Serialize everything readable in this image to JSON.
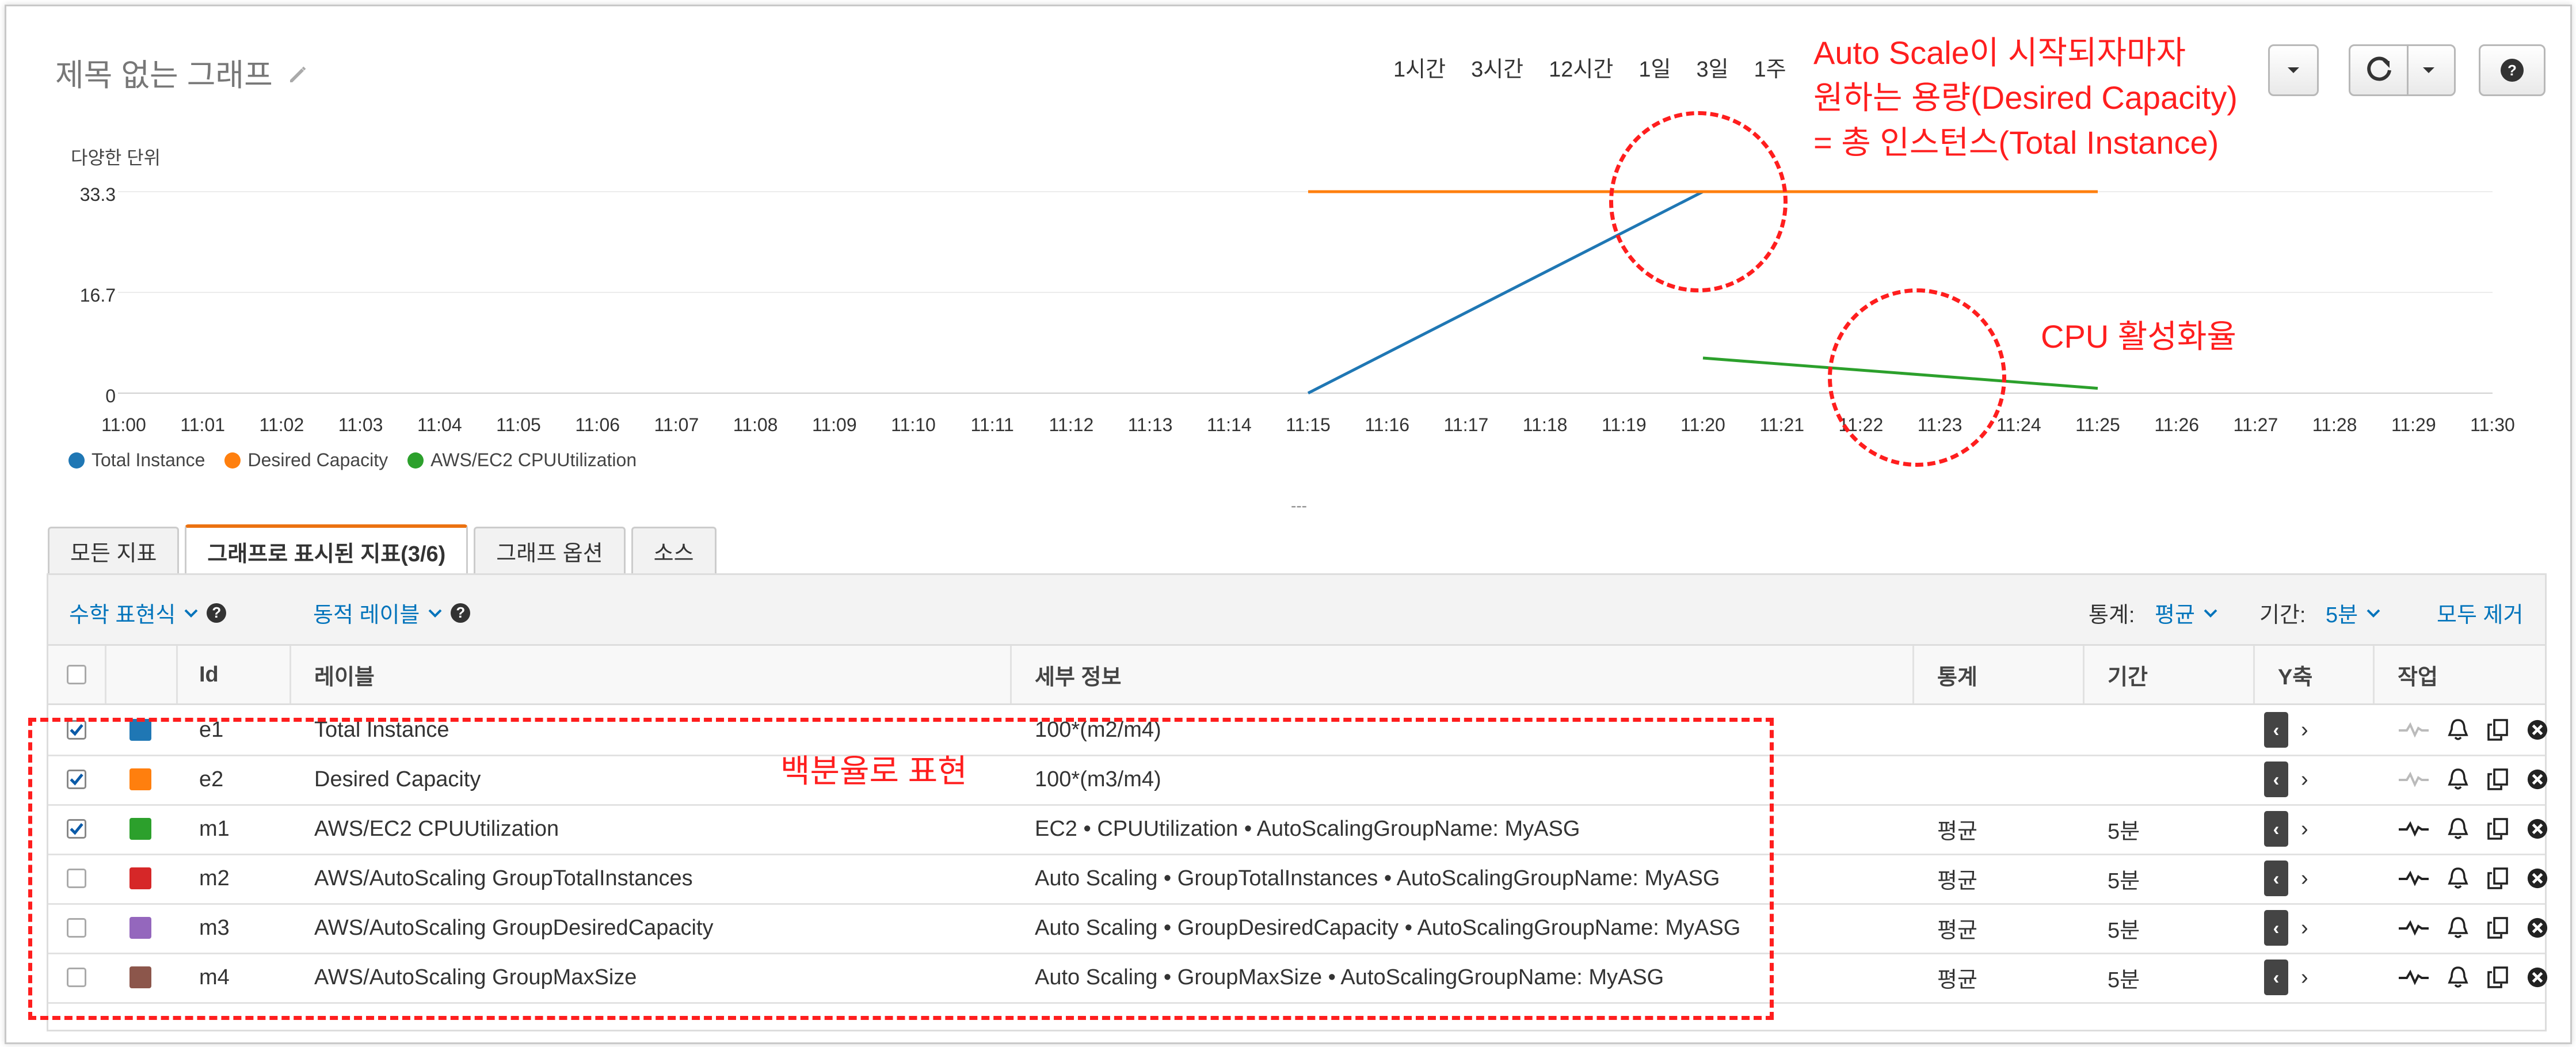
{
  "graph": {
    "title": "제목 없는 그래프",
    "time_ranges": [
      "1시간",
      "3시간",
      "12시간",
      "1일",
      "3일",
      "1주"
    ],
    "y_axis_label": "다양한 단위",
    "y_ticks": [
      "33.3",
      "16.7",
      "0"
    ],
    "x_ticks": [
      "11:00",
      "11:01",
      "11:02",
      "11:03",
      "11:04",
      "11:05",
      "11:06",
      "11:07",
      "11:08",
      "11:09",
      "11:10",
      "11:11",
      "11:12",
      "11:13",
      "11:14",
      "11:15",
      "11:16",
      "11:17",
      "11:18",
      "11:19",
      "11:20",
      "11:21",
      "11:22",
      "11:23",
      "11:24",
      "11:25",
      "11:26",
      "11:27",
      "11:28",
      "11:29",
      "11:30"
    ],
    "legend": [
      "Total Instance",
      "Desired Capacity",
      "AWS/EC2 CPUUtilization"
    ],
    "colors": {
      "total": "#1f77b4",
      "desired": "#ff7f0e",
      "cpu": "#2ca02c"
    }
  },
  "chart_data": {
    "type": "line",
    "x": [
      "11:15",
      "11:20",
      "11:25"
    ],
    "ylim": [
      0,
      33.3
    ],
    "ylabel": "다양한 단위",
    "series": [
      {
        "name": "Total Instance",
        "points": [
          [
            "11:15",
            0
          ],
          [
            "11:20",
            33.3
          ]
        ]
      },
      {
        "name": "Desired Capacity",
        "points": [
          [
            "11:15",
            33.3
          ],
          [
            "11:20",
            33.3
          ],
          [
            "11:25",
            33.3
          ]
        ]
      },
      {
        "name": "AWS/EC2 CPUUtilization",
        "points": [
          [
            "11:20",
            5.8
          ],
          [
            "11:25",
            0.8
          ]
        ]
      }
    ],
    "legend_position": "bottom-left",
    "grid": true
  },
  "annotations": {
    "autoscale": [
      "Auto Scale이 시작되자마자",
      "원하는 용량(Desired Capacity)",
      "= 총 인스턴스(Total Instance)"
    ],
    "cpu": "CPU 활성화율",
    "percent": "백분율로 표현"
  },
  "tabs": [
    "모든 지표",
    "그래프로 표시된 지표(3/6)",
    "그래프 옵션",
    "소스"
  ],
  "toolbar": {
    "math_expr": "수학 표현식",
    "dynamic_label": "동적 레이블",
    "stat_label": "통계:",
    "stat_value": "평균",
    "period_label": "기간:",
    "period_value": "5분",
    "remove_all": "모두 제거"
  },
  "table": {
    "headers": {
      "id": "Id",
      "label": "레이블",
      "details": "세부 정보",
      "stat": "통계",
      "period": "기간",
      "yaxis": "Y축",
      "actions": "작업"
    },
    "rows": [
      {
        "checked": true,
        "color": "#1f77b4",
        "id": "e1",
        "label": "Total Instance",
        "details": "100*(m2/m4)",
        "stat": "",
        "period": ""
      },
      {
        "checked": true,
        "color": "#ff7f0e",
        "id": "e2",
        "label": "Desired Capacity",
        "details": "100*(m3/m4)",
        "stat": "",
        "period": ""
      },
      {
        "checked": true,
        "color": "#2ca02c",
        "id": "m1",
        "label": "AWS/EC2 CPUUtilization",
        "details": "EC2 • CPUUtilization • AutoScalingGroupName: MyASG",
        "stat": "평균",
        "period": "5분"
      },
      {
        "checked": false,
        "color": "#d62728",
        "id": "m2",
        "label": "AWS/AutoScaling GroupTotalInstances",
        "details": "Auto Scaling • GroupTotalInstances • AutoScalingGroupName: MyASG",
        "stat": "평균",
        "period": "5분"
      },
      {
        "checked": false,
        "color": "#9467bd",
        "id": "m3",
        "label": "AWS/AutoScaling GroupDesiredCapacity",
        "details": "Auto Scaling • GroupDesiredCapacity • AutoScalingGroupName: MyASG",
        "stat": "평균",
        "period": "5분"
      },
      {
        "checked": false,
        "color": "#8c564b",
        "id": "m4",
        "label": "AWS/AutoScaling GroupMaxSize",
        "details": "Auto Scaling • GroupMaxSize • AutoScalingGroupName: MyASG",
        "stat": "평균",
        "period": "5분"
      }
    ]
  }
}
